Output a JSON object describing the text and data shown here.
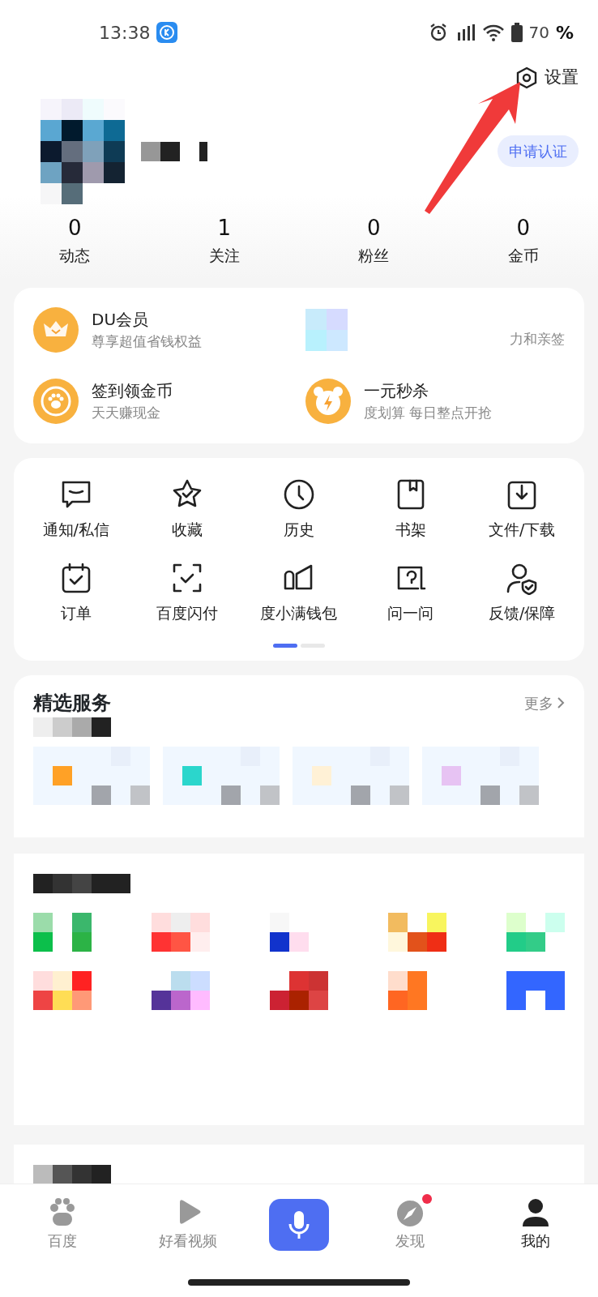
{
  "status_bar": {
    "time": "13:38",
    "battery": "70",
    "percent": "%"
  },
  "settings": {
    "label": "设置"
  },
  "profile": {
    "verify_button": "申请认证"
  },
  "stats": [
    {
      "value": "0",
      "label": "动态"
    },
    {
      "value": "1",
      "label": "关注"
    },
    {
      "value": "0",
      "label": "粉丝"
    },
    {
      "value": "0",
      "label": "金币"
    }
  ],
  "promos": [
    {
      "title": "DU会员",
      "subtitle": "尊享超值省钱权益"
    },
    {
      "subtitle": "力和亲签"
    },
    {
      "title": "签到领金币",
      "subtitle": "天天赚现金"
    },
    {
      "title": "一元秒杀",
      "subtitle": "度划算 每日整点开抢"
    }
  ],
  "tools": [
    {
      "label": "通知/私信"
    },
    {
      "label": "收藏"
    },
    {
      "label": "历史"
    },
    {
      "label": "书架"
    },
    {
      "label": "文件/下载"
    },
    {
      "label": "订单"
    },
    {
      "label": "百度闪付"
    },
    {
      "label": "度小满钱包"
    },
    {
      "label": "问一问"
    },
    {
      "label": "反馈/保障"
    }
  ],
  "pager": [
    {
      "selected": true
    },
    {
      "selected": false
    }
  ],
  "featured": {
    "title": "精选服务",
    "more": "更多"
  },
  "bottom_nav": [
    {
      "label": "百度",
      "selected": false,
      "badge": false
    },
    {
      "label": "好看视频",
      "selected": false,
      "badge": false
    },
    {
      "kind": "voice",
      "selected": false
    },
    {
      "label": "发现",
      "selected": false,
      "badge": true
    },
    {
      "label": "我的",
      "selected": true,
      "badge": false
    }
  ]
}
